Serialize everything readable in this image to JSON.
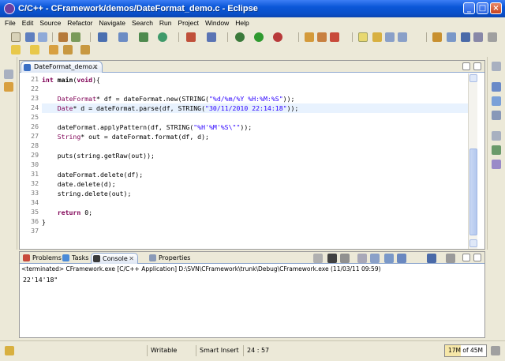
{
  "window": {
    "title": "C/C++ - CFramework/demos/DateFormat_demo.c - Eclipse"
  },
  "menu": [
    "File",
    "Edit",
    "Source",
    "Refactor",
    "Navigate",
    "Search",
    "Run",
    "Project",
    "Window",
    "Help"
  ],
  "editor": {
    "tab_label": "DateFormat_demo.c",
    "lines": [
      {
        "n": "21",
        "code": "int main(void){"
      },
      {
        "n": "22",
        "code": ""
      },
      {
        "n": "23",
        "code": "    DateFormat* df = dateFormat.new(STRING(\"%d/%m/%Y %H:%M:%S\"));"
      },
      {
        "n": "24",
        "code": "    Date* d = dateFormat.parse(df, STRING(\"30/11/2010 22:14:18\"));"
      },
      {
        "n": "25",
        "code": ""
      },
      {
        "n": "26",
        "code": "    dateFormat.applyPattern(df, STRING(\"%H'%M'%S\\\"\"));"
      },
      {
        "n": "27",
        "code": "    String* out = dateFormat.format(df, d);"
      },
      {
        "n": "28",
        "code": ""
      },
      {
        "n": "29",
        "code": "    puts(string.getRaw(out));"
      },
      {
        "n": "30",
        "code": ""
      },
      {
        "n": "31",
        "code": "    dateFormat.delete(df);"
      },
      {
        "n": "32",
        "code": "    date.delete(d);"
      },
      {
        "n": "33",
        "code": "    string.delete(out);"
      },
      {
        "n": "34",
        "code": ""
      },
      {
        "n": "35",
        "code": "    return 0;"
      },
      {
        "n": "36",
        "code": "}"
      },
      {
        "n": "37",
        "code": ""
      }
    ],
    "highlighted_line": "24"
  },
  "panel": {
    "tabs": [
      "Problems",
      "Tasks",
      "Console",
      "Properties"
    ],
    "active_tab": "Console",
    "terminated_text": "<terminated> CFramework.exe [C/C++ Application] D:\\SVN\\CFramework\\trunk\\Debug\\CFramework.exe (11/03/11 09:59)",
    "output": "22'14'18\""
  },
  "status": {
    "writable": "Writable",
    "insert_mode": "Smart Insert",
    "position": "24 : 57",
    "heap": "17M of 45M",
    "heap_used_fraction": 0.378
  },
  "colors": {
    "keyword": "#7f0055",
    "string": "#2a00ff",
    "titlebar": "#0b57d8",
    "current_line": "#e8f2fe"
  }
}
